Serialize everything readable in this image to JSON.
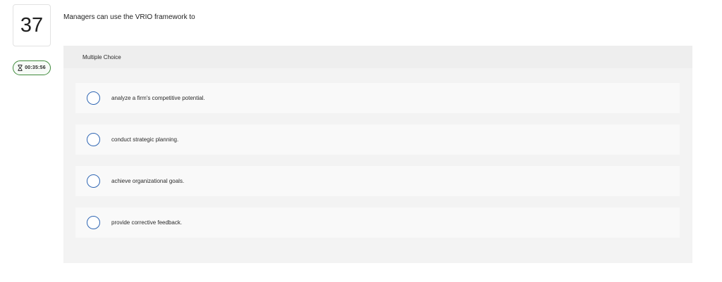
{
  "question": {
    "number": "37",
    "timer": "00:35:56",
    "prompt": "Managers can use the VRIO framework to",
    "type_label": "Multiple Choice"
  },
  "choices": [
    {
      "label": "analyze a firm's competitive potential."
    },
    {
      "label": "conduct strategic planning."
    },
    {
      "label": "achieve organizational goals."
    },
    {
      "label": "provide corrective feedback."
    }
  ],
  "icons": {
    "timer": "hourglass-icon"
  },
  "colors": {
    "timer_border": "#3f8a3b",
    "radio_border": "#2f66b3",
    "panel_bg": "#f3f3f3"
  }
}
